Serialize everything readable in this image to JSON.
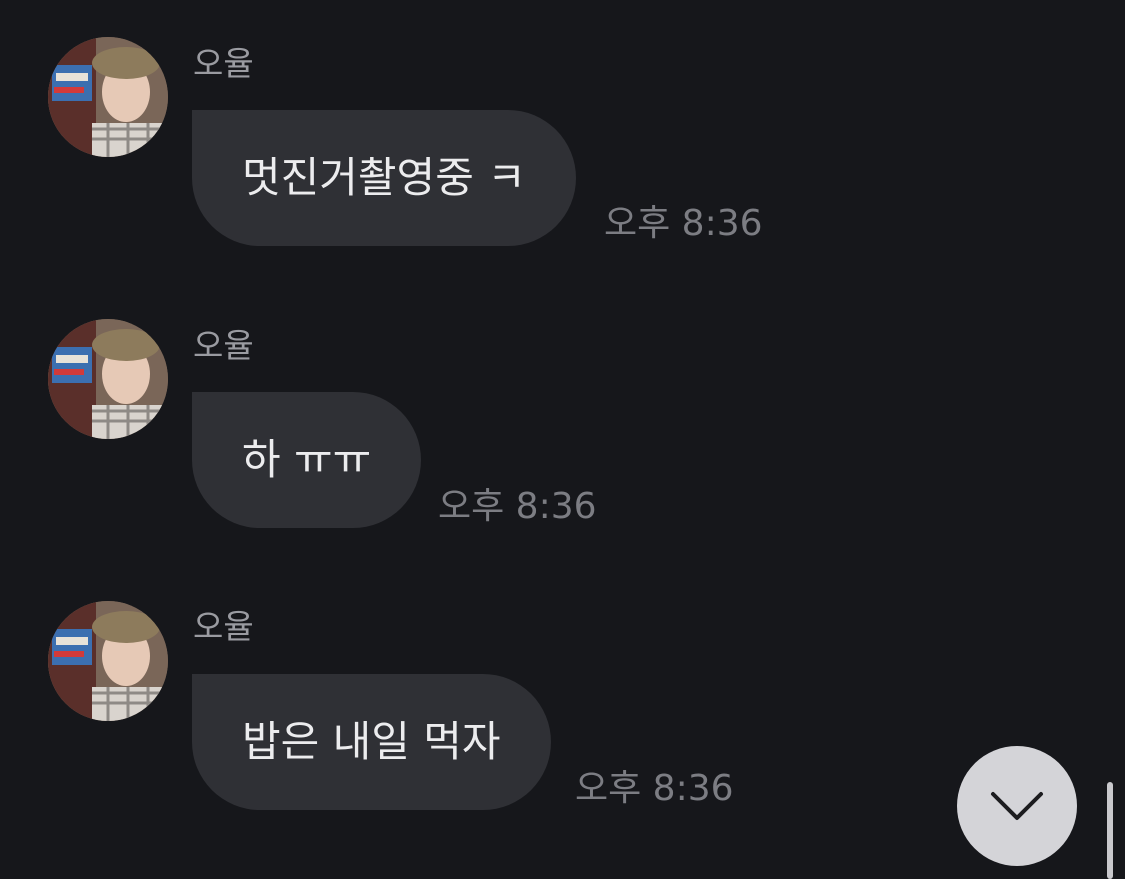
{
  "theme": {
    "background": "#16171b",
    "bubble": "#2f3035",
    "sender_text": "#9a9ba1",
    "time_text": "#7c7d83",
    "scroll_button": "#d4d4d8"
  },
  "messages": [
    {
      "sender": "오율",
      "text": "멋진거촬영중 ㅋ",
      "time": "오후 8:36",
      "avatar_icon": "profile-avatar"
    },
    {
      "sender": "오율",
      "text": "하 ㅠㅠ",
      "time": "오후 8:36",
      "avatar_icon": "profile-avatar"
    },
    {
      "sender": "오율",
      "text": "밥은 내일 먹자",
      "time": "오후 8:36",
      "avatar_icon": "profile-avatar"
    }
  ],
  "scroll_button": {
    "icon": "chevron-down-icon"
  }
}
